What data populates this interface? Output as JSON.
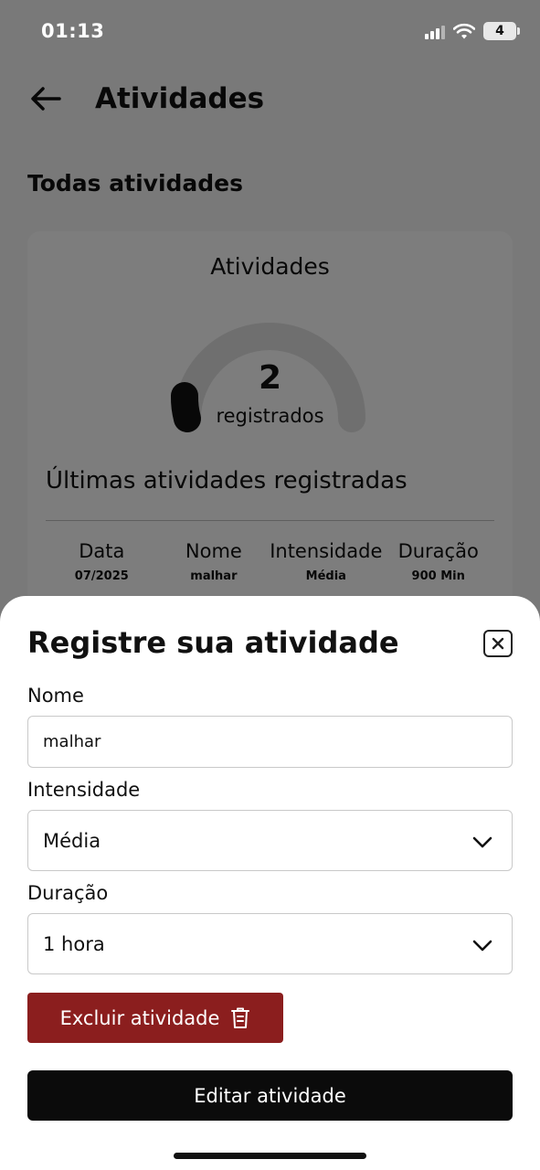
{
  "status_bar": {
    "time": "01:13",
    "battery": "4"
  },
  "header": {
    "title": "Atividades"
  },
  "section": {
    "title": "Todas atividades"
  },
  "card": {
    "title": "Atividades",
    "count": "2",
    "count_label": "registrados",
    "recent_title": "Últimas atividades registradas",
    "columns": [
      "Data",
      "Nome",
      "Intensidade",
      "Duração"
    ],
    "row": [
      "07/2025",
      "malhar",
      "Média",
      "900 Min"
    ]
  },
  "sheet": {
    "title": "Registre sua atividade",
    "name_label": "Nome",
    "name_value": "malhar",
    "intensity_label": "Intensidade",
    "intensity_value": "Média",
    "duration_label": "Duração",
    "duration_value": "1 hora",
    "delete_label": "Excluir atividade",
    "edit_label": "Editar atividade"
  },
  "colors": {
    "delete": "#8b1e1e",
    "primary": "#0b0b0b"
  },
  "icons": [
    "back-arrow-icon",
    "close-icon",
    "chevron-down-icon",
    "trash-icon",
    "signal-icon",
    "wifi-icon",
    "battery-icon"
  ]
}
